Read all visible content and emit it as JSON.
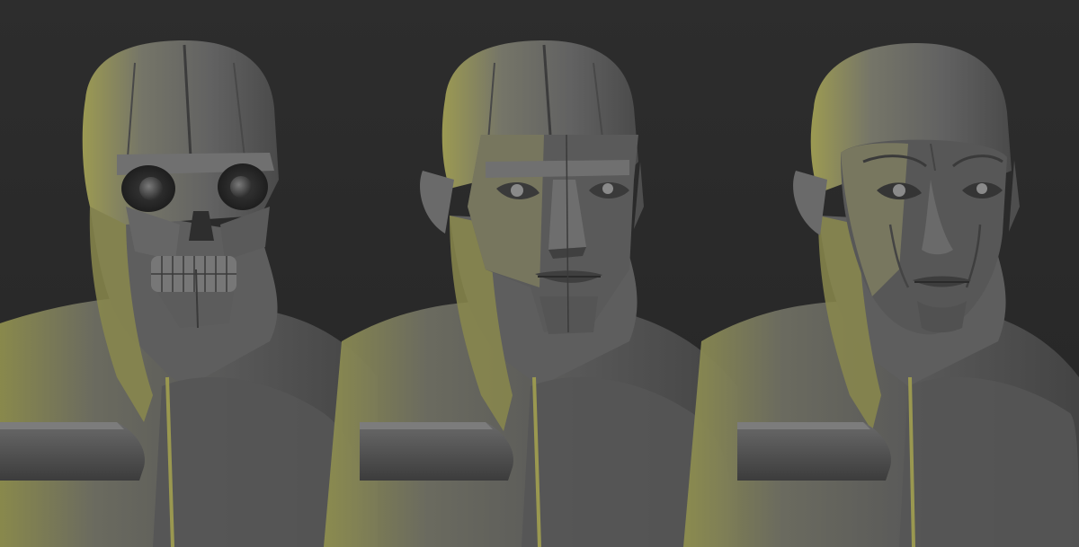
{
  "scene": {
    "background_color": "#2b2b2b",
    "clay_color": "#6a6a6a",
    "highlight_color": "#b8b65a",
    "figures": [
      {
        "stage": "skull",
        "icon": "skull-bust"
      },
      {
        "stage": "planar-face",
        "icon": "planar-head-bust"
      },
      {
        "stage": "detailed-face",
        "icon": "sculpted-head-bust"
      }
    ]
  }
}
